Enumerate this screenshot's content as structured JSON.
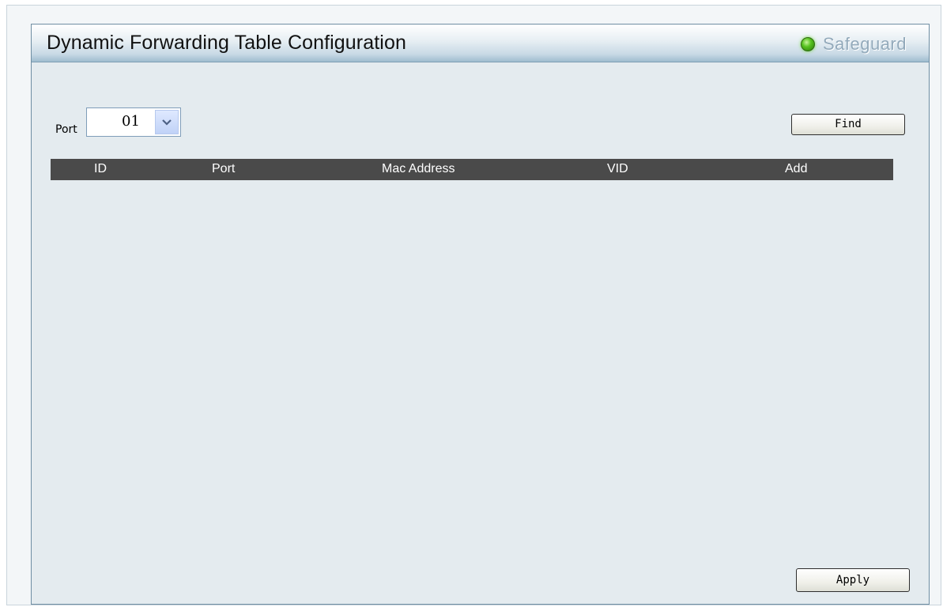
{
  "window": {
    "title": "Dynamic Forwarding Table Configuration"
  },
  "safeguard": {
    "label": "Safeguard",
    "status_color": "#57c21f",
    "icon": "status-led-icon"
  },
  "filter": {
    "port_label": "Port",
    "port_value": "01",
    "find_label": "Find"
  },
  "table": {
    "columns": [
      "ID",
      "Port",
      "Mac Address",
      "VID",
      "Add"
    ],
    "rows": []
  },
  "actions": {
    "apply_label": "Apply"
  },
  "colors": {
    "header_bg": "#4a4a4a",
    "panel_bg": "#e4ebef",
    "title_bar": "#c8d9e5"
  }
}
